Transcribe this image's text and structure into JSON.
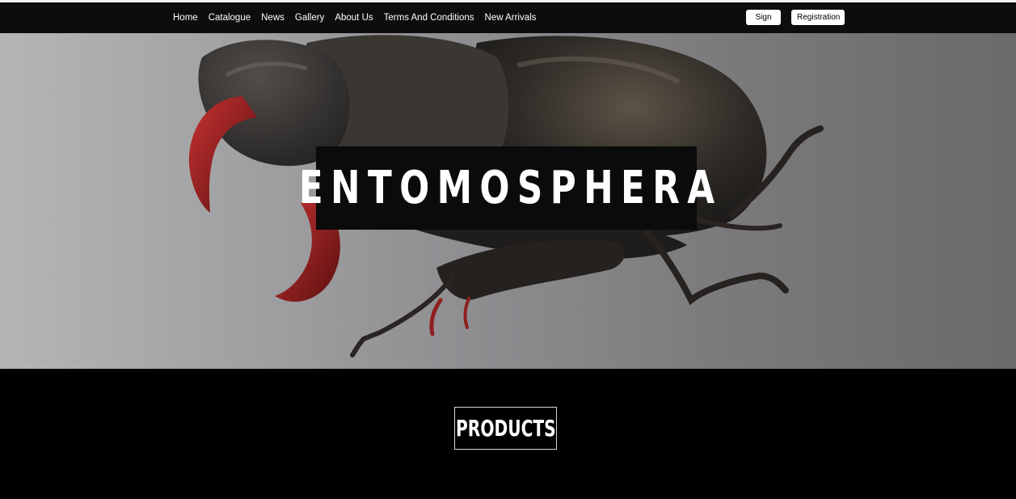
{
  "nav": {
    "links": [
      "Home",
      "Catalogue",
      "News",
      "Gallery",
      "About Us",
      "Terms And Conditions",
      "New Arrivals"
    ],
    "sign_in": "Sign In",
    "registration": "Registration"
  },
  "hero": {
    "title": "ENTOMOSPHERA",
    "image": "rhinoceros-beetle-photo"
  },
  "products": {
    "title": "PRODUCTS"
  },
  "colors": {
    "nav_background": "#0d0d0d",
    "page_background": "#000000",
    "hero_gradient_start": "#b5b5b6",
    "hero_gradient_end": "#6a6a6c",
    "beetle_body": "#2a2622",
    "beetle_mandible": "#8f1f1f"
  }
}
